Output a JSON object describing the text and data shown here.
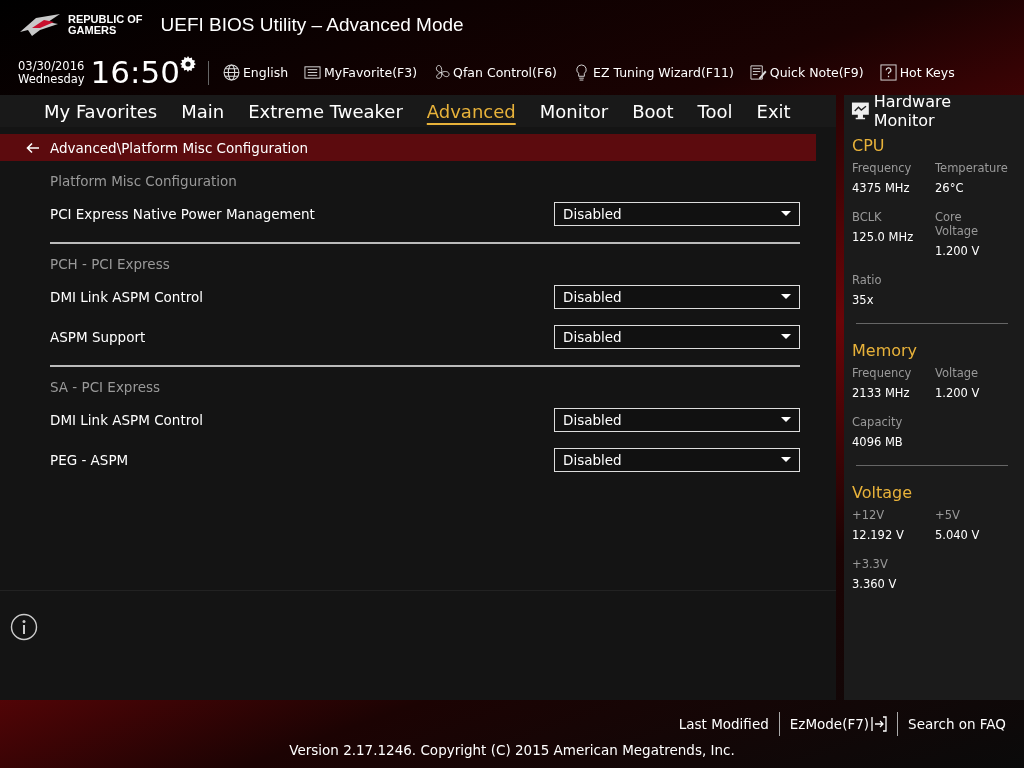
{
  "brand": {
    "line1": "REPUBLIC OF",
    "line2": "GAMERS"
  },
  "window": {
    "title": "UEFI BIOS Utility – Advanced Mode"
  },
  "clock": {
    "date": "03/30/2016",
    "day": "Wednesday",
    "time": "16:50"
  },
  "toolbar": [
    "English",
    "MyFavorite(F3)",
    "Qfan Control(F6)",
    "EZ Tuning Wizard(F11)",
    "Quick Note(F9)",
    "Hot Keys"
  ],
  "tabs": [
    {
      "label": "My Favorites",
      "selected": false
    },
    {
      "label": "Main",
      "selected": false
    },
    {
      "label": "Extreme Tweaker",
      "selected": false
    },
    {
      "label": "Advanced",
      "selected": true
    },
    {
      "label": "Monitor",
      "selected": false
    },
    {
      "label": "Boot",
      "selected": false
    },
    {
      "label": "Tool",
      "selected": false
    },
    {
      "label": "Exit",
      "selected": false
    }
  ],
  "breadcrumb": "Advanced\\Platform Misc Configuration",
  "settings": [
    {
      "kind": "section",
      "label": "Platform Misc Configuration"
    },
    {
      "kind": "setting",
      "label": "PCI Express Native Power Management",
      "value": "Disabled"
    },
    {
      "kind": "section",
      "label": "PCH - PCI Express"
    },
    {
      "kind": "setting",
      "label": "DMI Link ASPM Control",
      "value": "Disabled"
    },
    {
      "kind": "setting",
      "label": "ASPM Support",
      "value": "Disabled"
    },
    {
      "kind": "section",
      "label": "SA - PCI Express"
    },
    {
      "kind": "setting",
      "label": "DMI Link ASPM Control",
      "value": "Disabled"
    },
    {
      "kind": "setting",
      "label": "PEG - ASPM",
      "value": "Disabled"
    }
  ],
  "hardware_monitor": {
    "title": "Hardware Monitor",
    "sections": [
      {
        "title": "CPU",
        "items": [
          {
            "label": "Frequency",
            "value": "4375 MHz"
          },
          {
            "label": "Temperature",
            "value": "26°C"
          },
          {
            "label": "BCLK",
            "value": "125.0 MHz"
          },
          {
            "label": "Core Voltage",
            "value": "1.200 V"
          },
          {
            "label": "Ratio",
            "value": "35x"
          }
        ]
      },
      {
        "title": "Memory",
        "items": [
          {
            "label": "Frequency",
            "value": "2133 MHz"
          },
          {
            "label": "Voltage",
            "value": "1.200 V"
          },
          {
            "label": "Capacity",
            "value": "4096 MB"
          }
        ]
      },
      {
        "title": "Voltage",
        "items": [
          {
            "label": "+12V",
            "value": "12.192 V"
          },
          {
            "label": "+5V",
            "value": "5.040 V"
          },
          {
            "label": "+3.3V",
            "value": "3.360 V"
          }
        ]
      }
    ]
  },
  "footer": {
    "links": [
      "Last Modified",
      "EzMode(F7)",
      "Search on FAQ"
    ],
    "version": "Version 2.17.1246. Copyright (C) 2015 American Megatrends, Inc."
  }
}
